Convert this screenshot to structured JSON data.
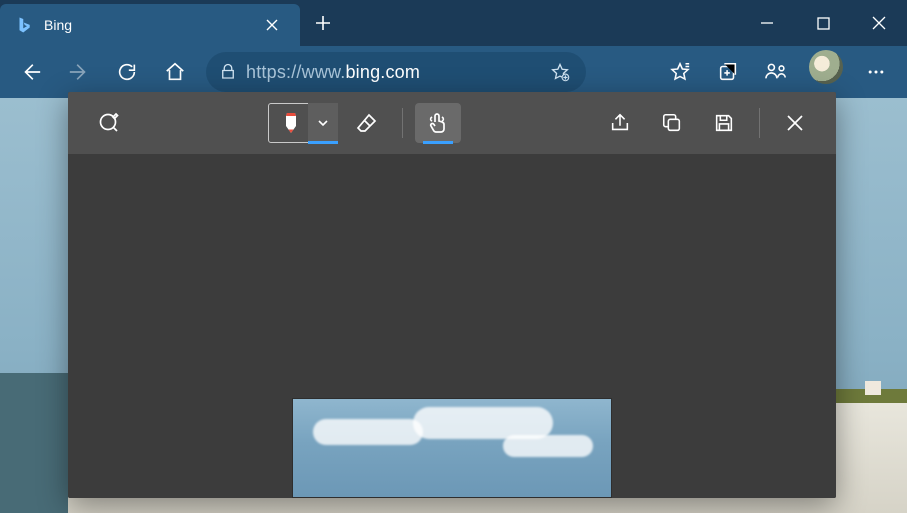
{
  "tab": {
    "title": "Bing"
  },
  "address": {
    "protocol": "https://",
    "host": "www.",
    "domain": "bing.com"
  },
  "browser": {
    "back_enabled": true,
    "forward_enabled": false
  },
  "webcapture": {
    "pen_color": "#e74c3c",
    "pen_active": true,
    "touch_active": true
  }
}
